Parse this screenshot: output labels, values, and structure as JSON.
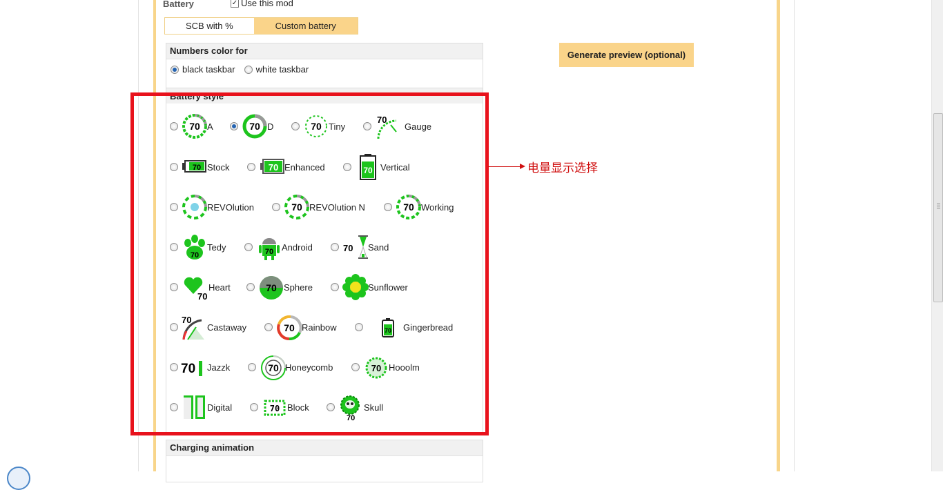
{
  "battery": {
    "label": "Battery",
    "use_mod": "Use this mod",
    "use_mod_checked": true
  },
  "tabs": [
    {
      "label": "SCB with %",
      "active": false
    },
    {
      "label": "Custom battery",
      "active": true
    }
  ],
  "numbers_color": {
    "title": "Numbers color for",
    "options": [
      {
        "label": "black taskbar",
        "selected": true
      },
      {
        "label": "white taskbar",
        "selected": false
      }
    ]
  },
  "battery_style": {
    "title": "Battery style",
    "value_shown": "70",
    "options": [
      {
        "label": "A",
        "selected": false,
        "icon": "ring-dashed-icon"
      },
      {
        "label": "D",
        "selected": true,
        "icon": "ring-solid-icon"
      },
      {
        "label": "Tiny",
        "selected": false,
        "icon": "ring-dotted-icon"
      },
      {
        "label": "Gauge",
        "selected": false,
        "icon": "gauge-icon"
      },
      {
        "label": "Stock",
        "selected": false,
        "icon": "battery-horizontal-icon"
      },
      {
        "label": "Enhanced",
        "selected": false,
        "icon": "battery-enhanced-icon"
      },
      {
        "label": "Vertical",
        "selected": false,
        "icon": "battery-vertical-icon"
      },
      {
        "label": "REVOlution",
        "selected": false,
        "icon": "revolution-icon"
      },
      {
        "label": "REVOlution N",
        "selected": false,
        "icon": "revolution-n-icon"
      },
      {
        "label": "Working",
        "selected": false,
        "icon": "working-icon"
      },
      {
        "label": "Tedy",
        "selected": false,
        "icon": "paw-icon"
      },
      {
        "label": "Android",
        "selected": false,
        "icon": "android-icon"
      },
      {
        "label": "Sand",
        "selected": false,
        "icon": "hourglass-icon"
      },
      {
        "label": "Heart",
        "selected": false,
        "icon": "heart-icon"
      },
      {
        "label": "Sphere",
        "selected": false,
        "icon": "sphere-icon"
      },
      {
        "label": "Sunflower",
        "selected": false,
        "icon": "sunflower-icon"
      },
      {
        "label": "Castaway",
        "selected": false,
        "icon": "castaway-gauge-icon"
      },
      {
        "label": "Rainbow",
        "selected": false,
        "icon": "rainbow-ring-icon"
      },
      {
        "label": "Gingerbread",
        "selected": false,
        "icon": "gingerbread-battery-icon"
      },
      {
        "label": "Jazzk",
        "selected": false,
        "icon": "jazzk-icon"
      },
      {
        "label": "Honeycomb",
        "selected": false,
        "icon": "honeycomb-arc-icon"
      },
      {
        "label": "Hooolm",
        "selected": false,
        "icon": "hooolm-icon"
      },
      {
        "label": "Digital",
        "selected": false,
        "icon": "digital-icon"
      },
      {
        "label": "Block",
        "selected": false,
        "icon": "block-icon"
      },
      {
        "label": "Skull",
        "selected": false,
        "icon": "skull-icon"
      }
    ]
  },
  "annotation": {
    "text": "电量显示选择"
  },
  "generate_button": {
    "label": "Generate preview (optional)"
  },
  "charging": {
    "title": "Charging animation"
  },
  "colors": {
    "accent": "#fad48a",
    "highlight": "#e8121c",
    "green": "#1dc41d"
  }
}
